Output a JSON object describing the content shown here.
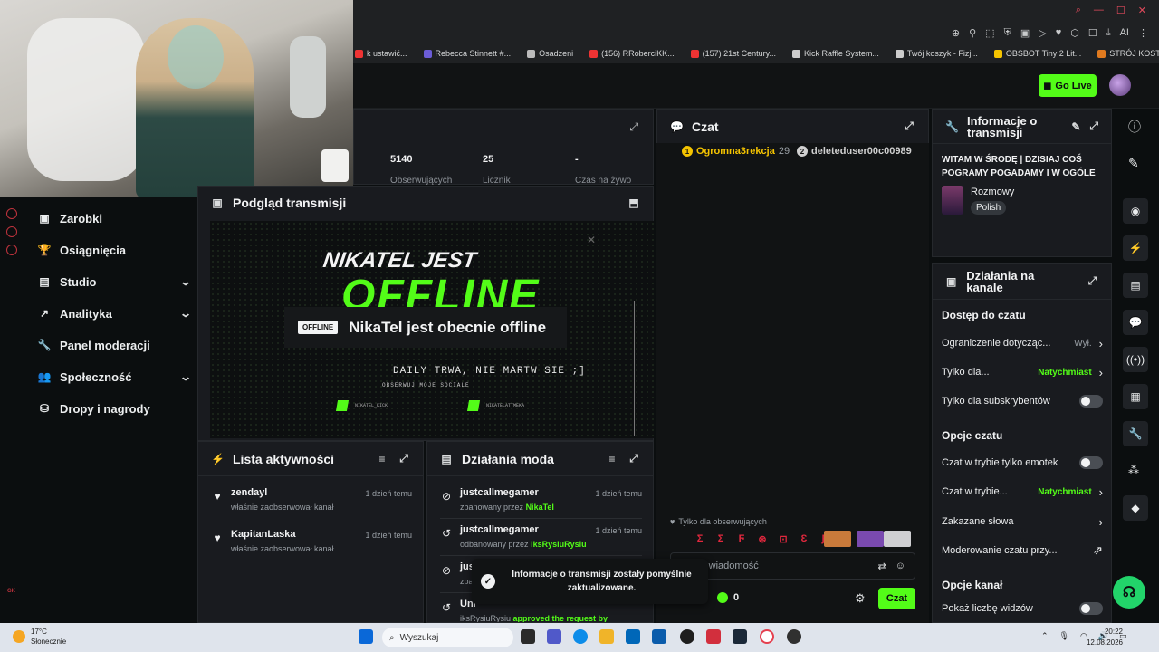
{
  "browser": {
    "bookmarks": [
      {
        "label": "k ustawić...",
        "color": "#e33"
      },
      {
        "label": "Rebecca Stinnett #...",
        "color": "#6b5cd6"
      },
      {
        "label": "Osadzeni",
        "color": "#bbb"
      },
      {
        "label": "(156) RRoberciKK...",
        "color": "#e33"
      },
      {
        "label": "(157) 21st Century...",
        "color": "#e33"
      },
      {
        "label": "Kick Raffle System...",
        "color": "#ccc"
      },
      {
        "label": "Twój koszyk - Fizj...",
        "color": "#ccc"
      },
      {
        "label": "OBSBOT Tiny 2 Lit...",
        "color": "#f5c400"
      },
      {
        "label": "STRÓJ KOSTIUM...",
        "color": "#e07a1f"
      }
    ],
    "toolbar_ai_label": "AI"
  },
  "header": {
    "go_live_label": "Go Live"
  },
  "sidebar": {
    "items": [
      {
        "label": "Zarobki",
        "icon": "wallet-icon",
        "glyph": "▣",
        "expandable": false
      },
      {
        "label": "Osiągnięcia",
        "icon": "trophy-icon",
        "glyph": "🏆",
        "expandable": false
      },
      {
        "label": "Studio",
        "icon": "studio-icon",
        "glyph": "▤",
        "expandable": true
      },
      {
        "label": "Analityka",
        "icon": "analytics-icon",
        "glyph": "↗",
        "expandable": true
      },
      {
        "label": "Panel moderacji",
        "icon": "wrench-icon",
        "glyph": "🔧",
        "expandable": false
      },
      {
        "label": "Społeczność",
        "icon": "community-icon",
        "glyph": "👥",
        "expandable": true
      },
      {
        "label": "Dropy i nagrody",
        "icon": "drops-icon",
        "glyph": "⛁",
        "expandable": false
      }
    ],
    "rail_label": "GK"
  },
  "stats": [
    {
      "value": "5140",
      "label": "Obserwujących"
    },
    {
      "value": "25",
      "label": "Licznik"
    },
    {
      "value": "-",
      "label": "Czas na żywo"
    }
  ],
  "preview": {
    "title": "Podgląd transmisji",
    "banner_line1": "NIKATEL JEST",
    "banner_big": "OFFLINE",
    "badge": "OFFLINE",
    "status_msg": "NikaTel jest obecnie offline",
    "daily": "DAILY TRWA, NIE MARTW SIE ;]",
    "follow": "OBSERWUJ MOJE SOCIALE",
    "social_1": "NIKATEL_KICK",
    "social_2": "NIKATELATTMEKA"
  },
  "activity": {
    "title": "Lista aktywności",
    "items": [
      {
        "name": "zendayl",
        "sub": "właśnie zaobserwował kanał",
        "time": "1 dzień temu"
      },
      {
        "name": "KapitanLaska",
        "sub": "właśnie zaobserwował kanał",
        "time": "1 dzień temu"
      }
    ]
  },
  "mod_actions": {
    "title": "Działania moda",
    "items": [
      {
        "name": "justcallmegamer",
        "sub_prefix": "zbanowany przez",
        "actor": "NikaTel",
        "time": "1 dzień temu",
        "icon": "ban-icon"
      },
      {
        "name": "justcallmegamer",
        "sub_prefix": "odbanowany przez",
        "actor": "iksRysiuRysiu",
        "time": "1 dzień temu",
        "icon": "unban-icon"
      },
      {
        "name": "just",
        "sub_prefix": "zba",
        "actor": "",
        "time": "",
        "icon": "ban-icon"
      },
      {
        "name": "Unl",
        "sub_prefix": "iksRysiuRysiu",
        "actor": "approved the request by",
        "time": "",
        "icon": "unban-icon"
      }
    ]
  },
  "chat": {
    "title": "Czat",
    "pinned": [
      {
        "name": "Ogromna3rekcja",
        "count": "29",
        "color": "#f5c400"
      },
      {
        "name": "deleteduser00c00989",
        "count": "",
        "color": "#d0d0d0"
      }
    ],
    "followers_only": "Tylko dla obserwujących",
    "input_placeholder": "Wyślij wiadomość",
    "points": "0",
    "send_label": "Czat"
  },
  "toast": {
    "message": "Informacje o transmisji zostały pomyślnie zaktualizowane."
  },
  "stream_info": {
    "title": "Informacje o transmisji",
    "stream_title": "WITAM W ŚRODĘ | DZISIAJ COŚ POGRAMY POGADAMY I W OGÓLE",
    "category": "Rozmowy",
    "language": "Polish"
  },
  "channel_actions": {
    "title": "Działania na kanale",
    "chat_access_heading": "Dostęp do czatu",
    "rows_access": [
      {
        "label": "Ograniczenie dotycząc...",
        "value": "Wył.",
        "type": "arrow"
      },
      {
        "label": "Tylko dla...",
        "value": "Natychmiast",
        "type": "arrow-green"
      },
      {
        "label": "Tylko dla subskrybentów",
        "value": "",
        "type": "toggle"
      }
    ],
    "chat_options_heading": "Opcje czatu",
    "rows_options": [
      {
        "label": "Czat w trybie tylko emotek",
        "value": "",
        "type": "toggle"
      },
      {
        "label": "Czat w trybie...",
        "value": "Natychmiast",
        "type": "arrow-green"
      },
      {
        "label": "Zakazane słowa",
        "value": "",
        "type": "arrow"
      },
      {
        "label": "Moderowanie czatu przy...",
        "value": "",
        "type": "external"
      }
    ],
    "channel_options_heading": "Opcje kanał",
    "show_viewers": "Pokaż liczbę widzów"
  },
  "taskbar": {
    "temp": "17°C",
    "weather": "Słonecznie",
    "search_placeholder": "Wyszukaj",
    "time": "20:22",
    "date": "12.08.2026"
  },
  "colors": {
    "accent": "#53fc18",
    "panel": "#191b1f",
    "bg": "#0b0e0f"
  }
}
